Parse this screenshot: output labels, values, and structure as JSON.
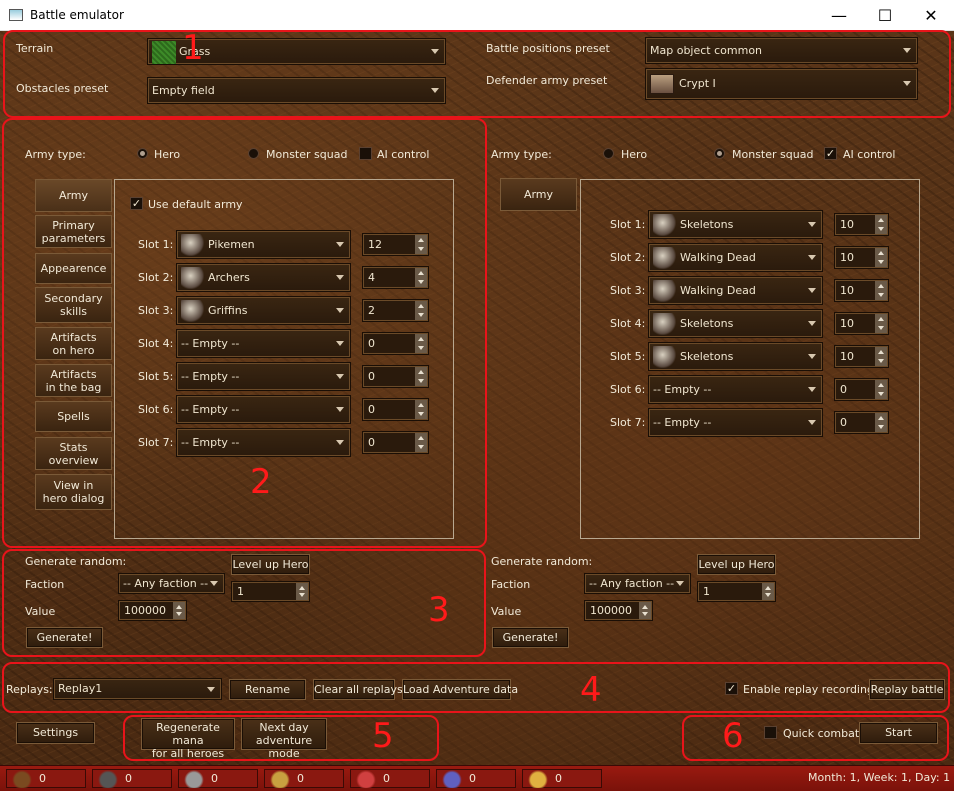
{
  "window": {
    "title": "Battle emulator",
    "min": "—",
    "max": "☐",
    "close": "✕"
  },
  "top": {
    "terrain_label": "Terrain",
    "terrain_value": "Grass",
    "obstacles_label": "Obstacles preset",
    "obstacles_value": "Empty field",
    "positions_label": "Battle positions preset",
    "positions_value": "Map object common",
    "defender_label": "Defender army preset",
    "defender_value": "Crypt I"
  },
  "left": {
    "army_type_label": "Army type:",
    "hero": "Hero",
    "monster": "Monster squad",
    "ai": "AI control",
    "hero_selected": true,
    "ai_checked": false,
    "tabs": [
      "Army",
      "Primary\nparameters",
      "Appearence",
      "Secondary\nskills",
      "Artifacts\non hero",
      "Artifacts\nin the bag",
      "Spells",
      "Stats\noverview",
      "View in\nhero dialog"
    ],
    "use_default": "Use default army",
    "use_default_checked": true,
    "slots": [
      {
        "label": "Slot 1:",
        "unit": "Pikemen",
        "count": "12"
      },
      {
        "label": "Slot 2:",
        "unit": "Archers",
        "count": "4"
      },
      {
        "label": "Slot 3:",
        "unit": "Griffins",
        "count": "2"
      },
      {
        "label": "Slot 4:",
        "unit": "-- Empty --",
        "count": "0"
      },
      {
        "label": "Slot 5:",
        "unit": "-- Empty --",
        "count": "0"
      },
      {
        "label": "Slot 6:",
        "unit": "-- Empty --",
        "count": "0"
      },
      {
        "label": "Slot 7:",
        "unit": "-- Empty --",
        "count": "0"
      }
    ],
    "gen": {
      "title": "Generate random:",
      "faction_label": "Faction",
      "faction": "-- Any faction --",
      "value_label": "Value",
      "value": "100000",
      "level_btn": "Level up Hero",
      "level": "1",
      "gen_btn": "Generate!"
    }
  },
  "right": {
    "army_type_label": "Army type:",
    "hero": "Hero",
    "monster": "Monster squad",
    "ai": "AI control",
    "monster_selected": true,
    "ai_checked": true,
    "tab": "Army",
    "slots": [
      {
        "label": "Slot 1:",
        "unit": "Skeletons",
        "count": "10"
      },
      {
        "label": "Slot 2:",
        "unit": "Walking Dead",
        "count": "10"
      },
      {
        "label": "Slot 3:",
        "unit": "Walking Dead",
        "count": "10"
      },
      {
        "label": "Slot 4:",
        "unit": "Skeletons",
        "count": "10"
      },
      {
        "label": "Slot 5:",
        "unit": "Skeletons",
        "count": "10"
      },
      {
        "label": "Slot 6:",
        "unit": "-- Empty --",
        "count": "0"
      },
      {
        "label": "Slot 7:",
        "unit": "-- Empty --",
        "count": "0"
      }
    ],
    "gen": {
      "title": "Generate random:",
      "faction_label": "Faction",
      "faction": "-- Any faction --",
      "value_label": "Value",
      "value": "100000",
      "level_btn": "Level up Hero",
      "level": "1",
      "gen_btn": "Generate!"
    }
  },
  "replays": {
    "label": "Replays:",
    "value": "Replay1",
    "rename": "Rename",
    "clear": "Clear all replays",
    "load": "Load Adventure data",
    "enable": "Enable replay recording",
    "enable_checked": true,
    "replay_btn": "Replay battle"
  },
  "bottom": {
    "settings": "Settings",
    "regen": "Regenerate mana\nfor all heroes",
    "nextday": "Next day\nadventure mode",
    "quick": "Quick combat",
    "quick_checked": false,
    "start": "Start"
  },
  "annotations": [
    "1",
    "2",
    "3",
    "4",
    "5",
    "6"
  ],
  "resources": [
    {
      "icon": "wood-icon",
      "value": "0"
    },
    {
      "icon": "mercury-icon",
      "value": "0"
    },
    {
      "icon": "ore-icon",
      "value": "0"
    },
    {
      "icon": "sulfur-icon",
      "value": "0"
    },
    {
      "icon": "crystal-icon",
      "value": "0"
    },
    {
      "icon": "gems-icon",
      "value": "0"
    },
    {
      "icon": "gold-icon",
      "value": "0"
    }
  ],
  "date": "Month: 1, Week: 1, Day: 1"
}
